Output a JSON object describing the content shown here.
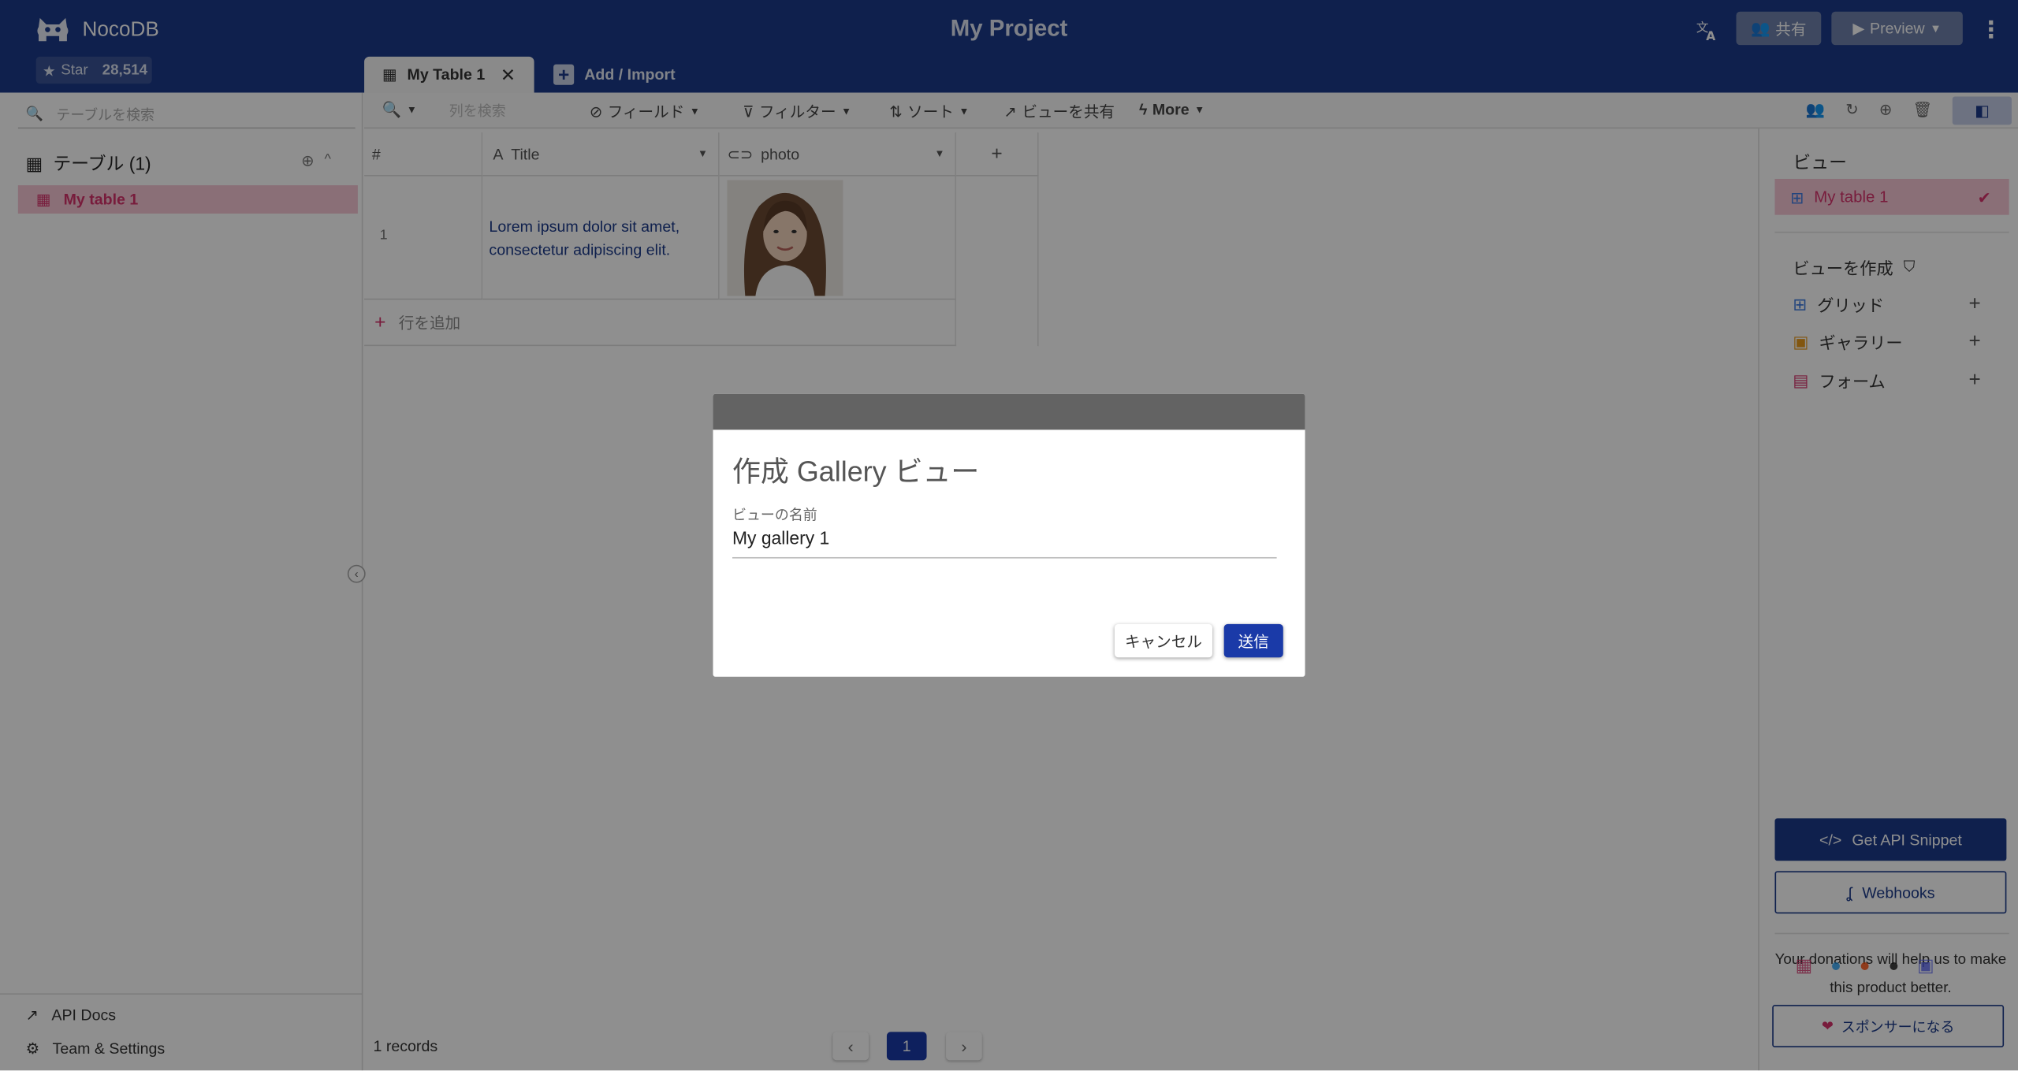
{
  "header": {
    "brand": "NocoDB",
    "star_label": "Star",
    "star_count": "28,514",
    "project_title": "My Project",
    "share_label": "共有",
    "preview_label": "Preview"
  },
  "tabs": {
    "active_label": "My Table 1",
    "add_label": "Add / Import"
  },
  "sidebar": {
    "search_placeholder": "テーブルを検索",
    "tables_header": "テーブル (1)",
    "table_item": "My table 1",
    "api_docs": "API Docs",
    "team_settings": "Team & Settings"
  },
  "toolbar": {
    "column_search_placeholder": "列を検索",
    "fields": "フィールド",
    "filter": "フィルター",
    "sort": "ソート",
    "share_view": "ビューを共有",
    "more": "More"
  },
  "grid": {
    "columns": [
      "#",
      "Title",
      "photo"
    ],
    "rows": [
      {
        "num": "1",
        "title": "Lorem ipsum dolor sit amet, consectetur adipiscing elit."
      }
    ],
    "add_row": "行を追加"
  },
  "right_panel": {
    "views_title": "ビュー",
    "current_view": "My table 1",
    "create_title": "ビューを作成",
    "create_grid": "グリッド",
    "create_gallery": "ギャラリー",
    "create_form": "フォーム",
    "api_snippet": "Get API Snippet",
    "webhooks": "Webhooks",
    "donation_text": "Your donations will help us to make this product better.",
    "sponsor": "スポンサーになる"
  },
  "footer": {
    "records": "1 records",
    "page": "1"
  },
  "dialog": {
    "title": "作成 Gallery ビュー",
    "name_label": "ビューの名前",
    "name_value": "My gallery 1",
    "cancel": "キャンセル",
    "submit": "送信"
  },
  "colors": {
    "header_bg": "#1b3a8a",
    "accent_pink": "#d6336c",
    "primary_button": "#1a3aa8"
  }
}
